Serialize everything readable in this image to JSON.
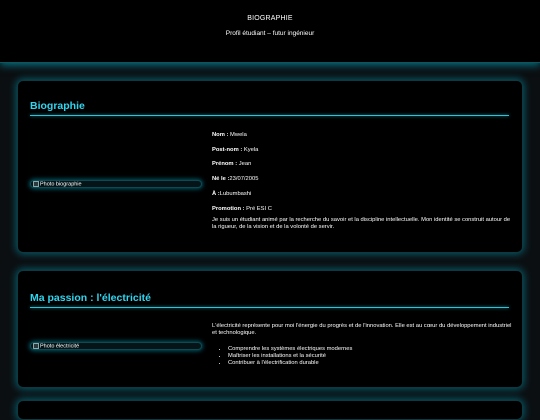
{
  "header": {
    "title": "BIOGRAPHIE",
    "subtitle": "Profil étudiant – futur ingénieur"
  },
  "biography": {
    "heading": "Biographie",
    "photo_alt": "Photo biographie",
    "fields": [
      {
        "label": "Nom :",
        "value": " Mwela"
      },
      {
        "label": "Post-nom :",
        "value": " Kyela"
      },
      {
        "label": "Prénom :",
        "value": " Jean"
      },
      {
        "label": "Né le :",
        "value": "23/07/2005"
      },
      {
        "label": "À :",
        "value": "Lubumbashi"
      },
      {
        "label": "Promotion :",
        "value": " Pré ESI C"
      }
    ],
    "description": "Je suis un étudiant animé par la recherche du savoir et la discipline intellectuelle. Mon identité se construit autour de la rigueur, de la vision et de la volonté de servir."
  },
  "passion": {
    "heading": "Ma passion : l'électricité",
    "photo_alt": "Photo électricité",
    "intro": "L'électricité représente pour moi l'énergie du progrès et de l'innovation. Elle est au cœur du développement industriel et technologique.",
    "items": [
      "Comprendre les systèmes électriques modernes",
      "Maîtriser les installations et la sécurité",
      "Contribuer à l'électrification durable"
    ]
  },
  "colors": {
    "accent": "#2fd6f0",
    "background": "#0b0f12",
    "card": "#000000"
  }
}
